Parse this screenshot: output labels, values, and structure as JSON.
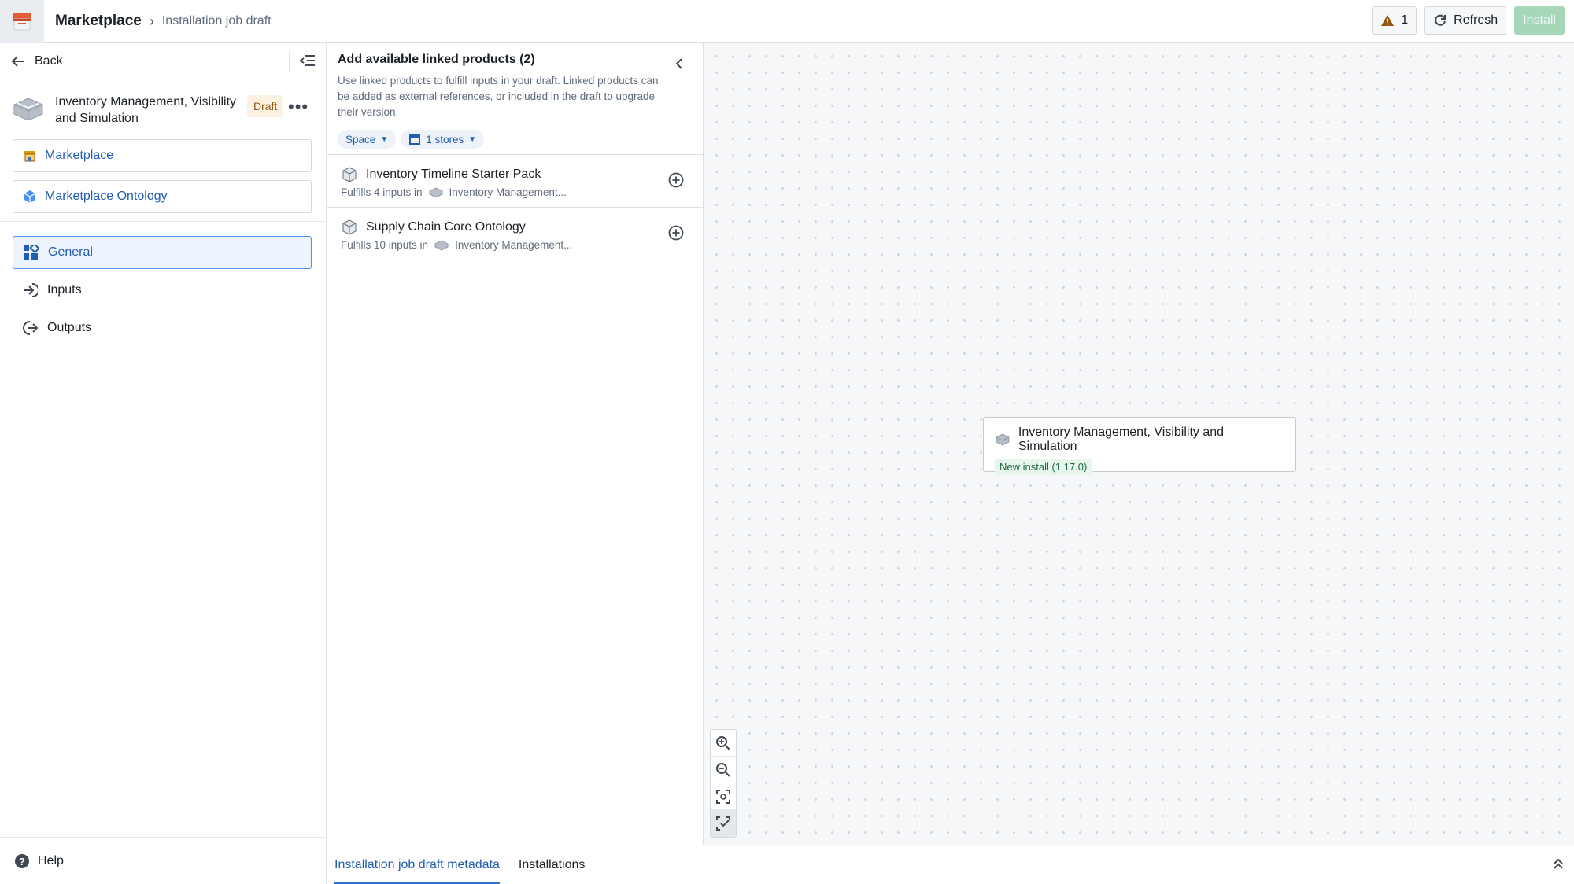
{
  "header": {
    "app_name": "Marketplace",
    "breadcrumb_current": "Installation job draft",
    "warning_count": "1",
    "refresh_label": "Refresh",
    "install_label": "Install"
  },
  "sidebar": {
    "back_label": "Back",
    "product_title": "Inventory Management, Visibility and Simulation",
    "draft_badge": "Draft",
    "links": [
      {
        "label": "Marketplace",
        "icon": "store-icon"
      },
      {
        "label": "Marketplace Ontology",
        "icon": "cube-icon"
      }
    ],
    "nav": [
      {
        "label": "General",
        "icon": "dashboard-icon",
        "active": true
      },
      {
        "label": "Inputs",
        "icon": "log-in-icon",
        "active": false
      },
      {
        "label": "Outputs",
        "icon": "log-out-icon",
        "active": false
      }
    ],
    "help_label": "Help"
  },
  "linked_panel": {
    "title": "Add available linked products (2)",
    "description": "Use linked products to fulfill inputs in your draft. Linked products can be added as external references, or included in the draft to upgrade their version.",
    "filters": {
      "space": "Space",
      "stores": "1 stores"
    },
    "items": [
      {
        "name": "Inventory Timeline Starter Pack",
        "fulfills": "Fulfills 4 inputs in",
        "target": "Inventory Management..."
      },
      {
        "name": "Supply Chain Core Ontology",
        "fulfills": "Fulfills 10 inputs in",
        "target": "Inventory Management..."
      }
    ]
  },
  "canvas": {
    "node_title": "Inventory Management, Visibility and Simulation",
    "node_tag": "New install (1.17.0)"
  },
  "bottom_tabs": [
    {
      "label": "Installation job draft metadata",
      "active": true
    },
    {
      "label": "Installations",
      "active": false
    }
  ],
  "colors": {
    "accent": "#215db0",
    "install_disabled": "#a6d7b8",
    "draft_badge_bg": "#fbf2e4",
    "warning": "#935610"
  }
}
